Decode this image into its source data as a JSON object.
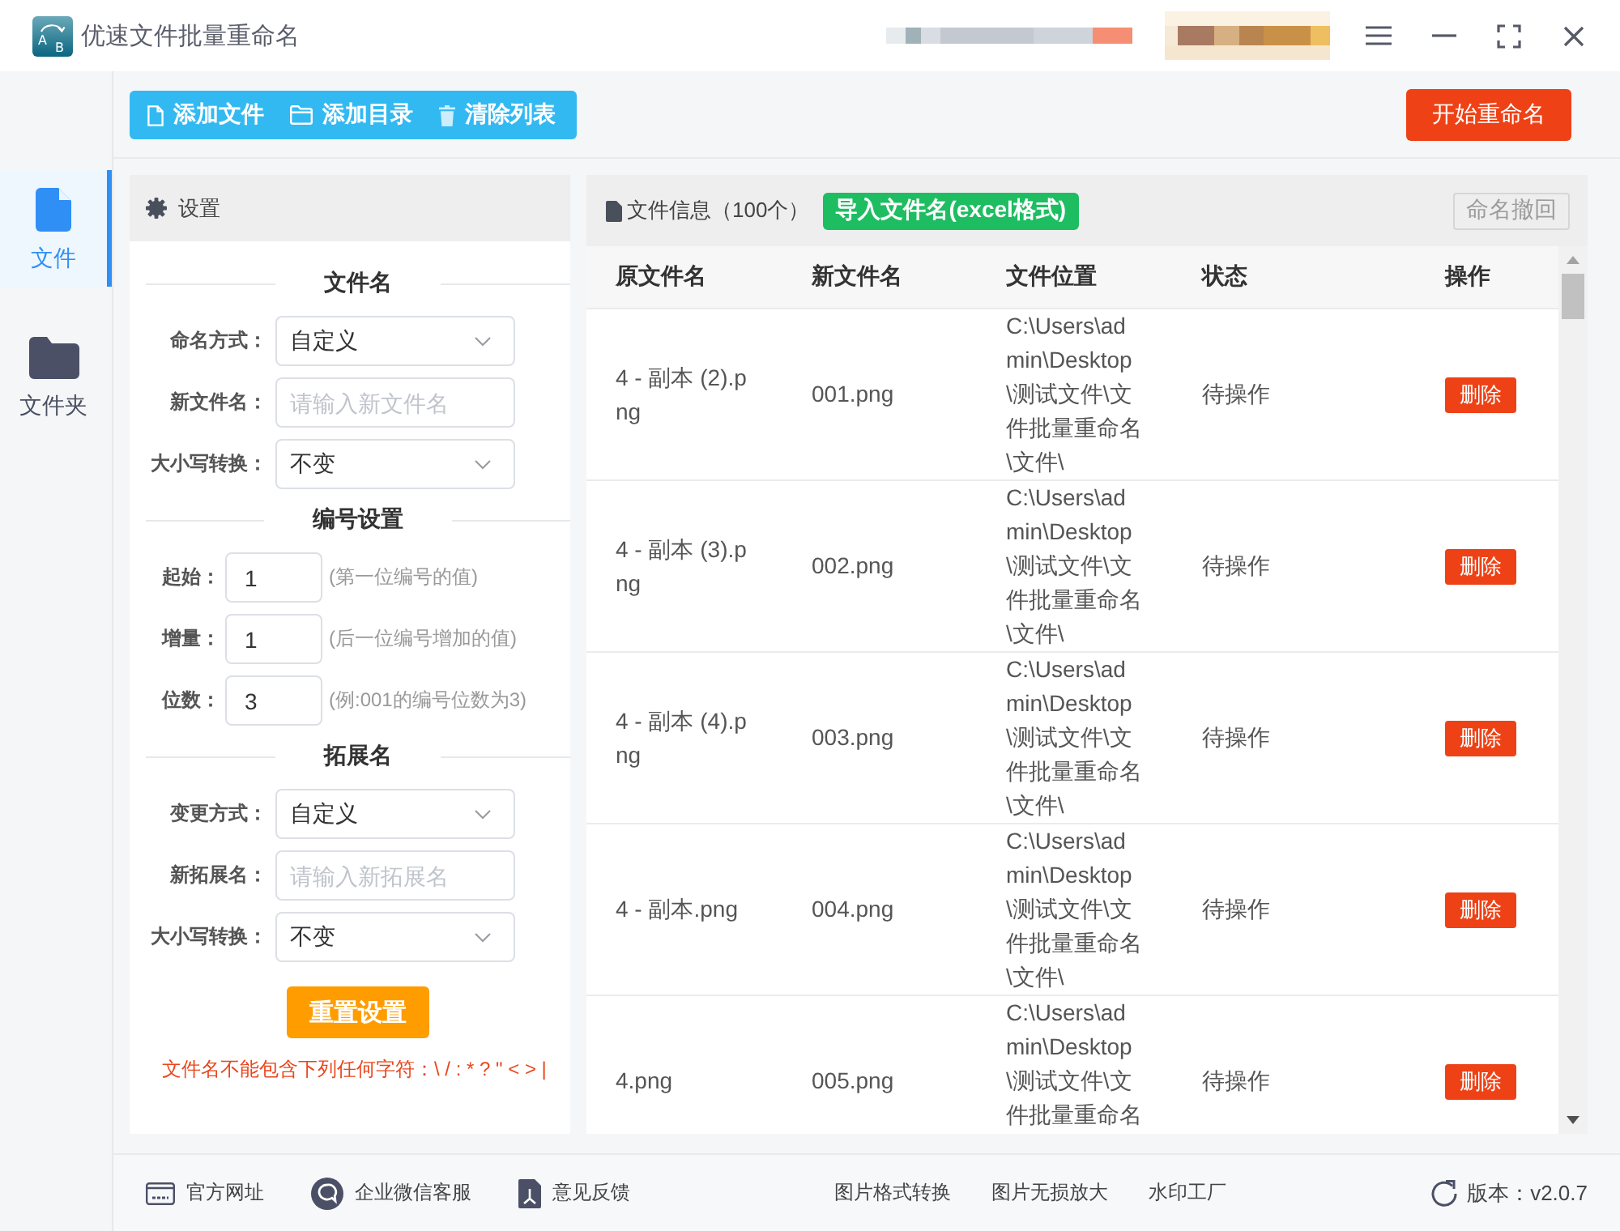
{
  "window": {
    "logo_letters": [
      "A",
      "B"
    ],
    "title": "优速文件批量重命名"
  },
  "nav": [
    {
      "kind": "file",
      "label": "文件",
      "selected": true
    },
    {
      "kind": "folder",
      "label": "文件夹",
      "selected": false
    }
  ],
  "toolbar": {
    "buttons": [
      {
        "kind": "file",
        "label": "添加文件"
      },
      {
        "kind": "folder",
        "label": "添加目录"
      },
      {
        "kind": "trash",
        "label": "清除列表"
      }
    ],
    "start_button": "开始重命名"
  },
  "settings": {
    "title": "设置",
    "sections": [
      {
        "title": "文件名",
        "fields": [
          {
            "kind": "select",
            "label": "命名方式：",
            "value": "自定义"
          },
          {
            "kind": "input",
            "label": "新文件名：",
            "placeholder": "请输入新文件名"
          },
          {
            "kind": "select",
            "label": "大小写转换：",
            "value": "不变"
          }
        ]
      },
      {
        "title": "编号设置",
        "fields": [
          {
            "kind": "number",
            "label": "起始：",
            "value": "1",
            "hint": "(第一位编号的值)"
          },
          {
            "kind": "number",
            "label": "增量：",
            "value": "1",
            "hint": "(后一位编号增加的值)"
          },
          {
            "kind": "number",
            "label": "位数：",
            "value": "3",
            "hint": "(例:001的编号位数为3)"
          }
        ]
      },
      {
        "title": "拓展名",
        "fields": [
          {
            "kind": "select",
            "label": "变更方式：",
            "value": "自定义"
          },
          {
            "kind": "input",
            "label": "新拓展名：",
            "placeholder": "请输入新拓展名"
          },
          {
            "kind": "select",
            "label": "大小写转换：",
            "value": "不变"
          }
        ]
      }
    ],
    "reset_button": "重置设置",
    "warning": "文件名不能包含下列任何字符：\\ / : * ? \" < > |"
  },
  "file_panel": {
    "title": "文件信息（100个）",
    "import_button": "导入文件名(excel格式)",
    "undo_button": {
      "label": "命名撤回",
      "disabled": true
    },
    "table": {
      "columns": [
        "原文件名",
        "新文件名",
        "文件位置",
        "状态",
        "操作"
      ],
      "rows": [
        {
          "original_name": "4 - 副本 (2).png",
          "new_name": "001.png",
          "location": "C:\\Users\\admin\\Desktop\\测试文件\\文件批量重命名\\文件\\",
          "status": "待操作",
          "action": "删除"
        },
        {
          "original_name": "4 - 副本 (3).png",
          "new_name": "002.png",
          "location": "C:\\Users\\admin\\Desktop\\测试文件\\文件批量重命名\\文件\\",
          "status": "待操作",
          "action": "删除"
        },
        {
          "original_name": "4 - 副本 (4).png",
          "new_name": "003.png",
          "location": "C:\\Users\\admin\\Desktop\\测试文件\\文件批量重命名\\文件\\",
          "status": "待操作",
          "action": "删除"
        },
        {
          "original_name": "4 - 副本.png",
          "new_name": "004.png",
          "location": "C:\\Users\\admin\\Desktop\\测试文件\\文件批量重命名\\文件\\",
          "status": "待操作",
          "action": "删除"
        },
        {
          "original_name": "4.png",
          "new_name": "005.png",
          "location": "C:\\Users\\admin\\Desktop\\测试文件\\文件批量重命名",
          "status": "待操作",
          "action": "删除"
        }
      ]
    }
  },
  "footer": {
    "links": [
      {
        "kind": "website",
        "label": "官方网址"
      },
      {
        "kind": "chat",
        "label": "企业微信客服"
      },
      {
        "kind": "feedback",
        "label": "意见反馈"
      }
    ],
    "tools": [
      "图片格式转换",
      "图片无损放大",
      "水印工厂"
    ],
    "version": "版本：v2.0.7"
  }
}
